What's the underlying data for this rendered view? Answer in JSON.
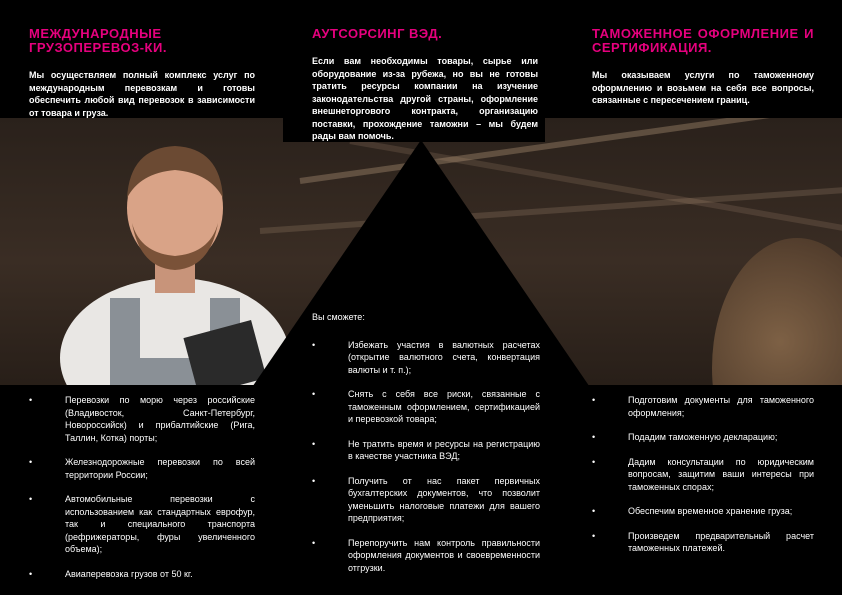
{
  "left": {
    "heading": "МЕЖДУНАРОДНЫЕ ГРУЗОПЕРЕВОЗ-КИ.",
    "intro": "Мы осуществляем полный комплекс услуг по международным перевозкам и готовы обеспечить любой вид перевозок в зависимости от товара и груза.",
    "items": [
      "Перевозки по морю через российские (Владивосток, Санкт-Петербург, Новороссийск) и прибалтийские (Рига, Таллин, Котка) порты;",
      "Железнодорожные перевозки по всей территории России;",
      "Автомобильные перевозки с использованием как стандартных еврофур, так и специального транспорта (рефрижераторы, фуры увеличенного объема);",
      "Авиаперевозка грузов от 50 кг."
    ]
  },
  "middle": {
    "heading": "АУТСОРСИНГ ВЭД.",
    "intro": "Если вам необходимы товары, сырье или оборудование из-за рубежа, но вы не готовы тратить ресурсы компании на изучение законодательства другой страны, оформление внешнеторгового контракта, организацию поставки, прохождение таможни – мы будем рады вам помочь.",
    "lead": "Вы сможете:",
    "items": [
      "Избежать участия в валютных расчетах (открытие валютного счета, конвертация валюты и т. п.);",
      "Снять с себя все риски, связанные с таможенным оформлением, сертификацией и перевозкой товара;",
      "Не тратить время и ресурсы на регистрацию в качестве участника ВЭД;",
      "Получить от нас пакет первичных бухгалтерских документов, что позволит уменьшить налоговые платежи для вашего предприятия;",
      "Перепоручить нам контроль правильности оформления документов и своевременности отгрузки."
    ]
  },
  "right": {
    "heading": "ТАМОЖЕННОЕ ОФОРМЛЕНИЕ И СЕРТИФИКАЦИЯ.",
    "intro": "Мы оказываем услуги по таможенному оформлению и возьмем на себя все вопросы, связанные с пересечением границ.",
    "items": [
      "Подготовим документы для таможенного оформления;",
      "Подадим таможенную декларацию;",
      "Дадим консультации по юридическим вопросам, защитим ваши интересы при таможенных спорах;",
      "Обеспечим временное хранение груза;",
      "Произведем предварительный расчет таможенных платежей."
    ]
  },
  "bullet": "•",
  "colors": {
    "accent": "#e6007e",
    "background": "#000000",
    "text": "#ffffff"
  }
}
